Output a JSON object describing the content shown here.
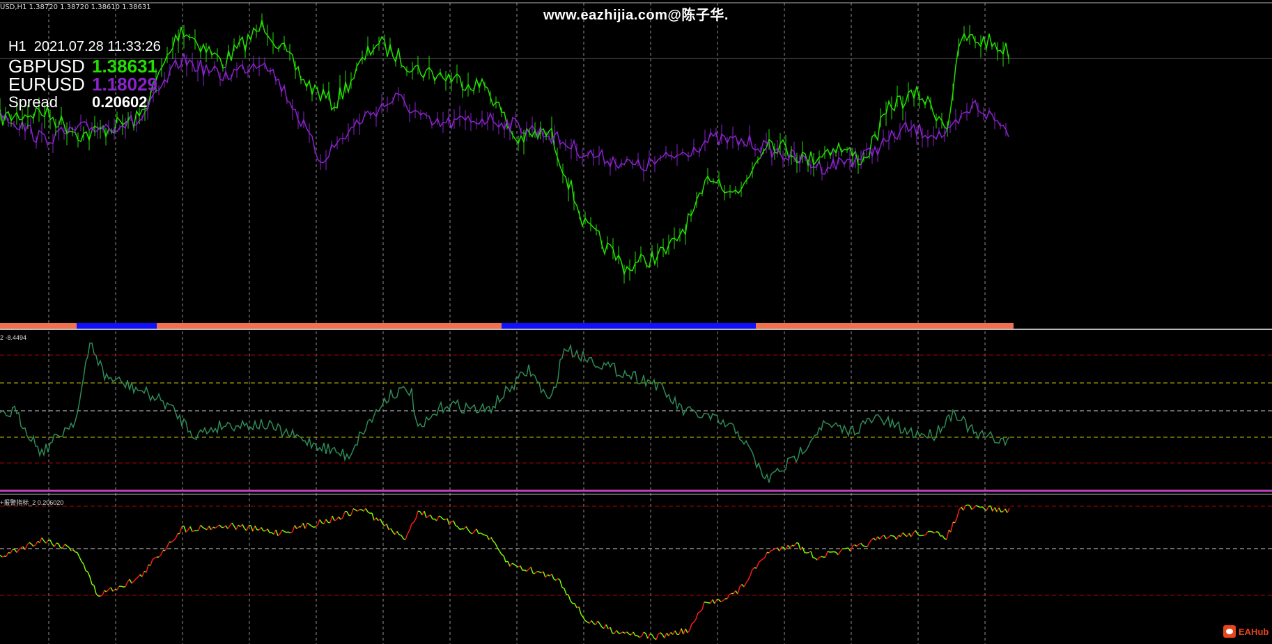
{
  "top_info": "USD,H1  1.38720 1.38720 1.38610 1.38631",
  "watermark": "www.eazhijia.com@陈子华.",
  "timeframe": "H1",
  "datetime": "2021.07.28 11:33:26",
  "symbols": [
    {
      "label": "GBPUSD",
      "value": "1.38631",
      "color": "#22e000"
    },
    {
      "label": "EURUSD",
      "value": "1.18029",
      "color": "#8a22cc"
    },
    {
      "label": "Spread",
      "value": "0.20602",
      "color": "#ffffff"
    }
  ],
  "subwindow_1_label": "2 -8.4494",
  "subwindow_2_label": "+报警指标_2 0.206020",
  "brand": "EAHub",
  "colors": {
    "background": "#000000",
    "grid": "#b4b4b4",
    "gbpusd": "#22e000",
    "eurusd": "#8a22cc",
    "osc_line": "#2e8b57",
    "spread_up": "#7cfc00",
    "spread_down": "#ff1a1a",
    "level_red": "#b00000",
    "level_yellow": "#c8c800",
    "signal_salmon": "#f07050",
    "signal_blue": "#1010ff",
    "separator_magenta": "#c040c0"
  },
  "icons": [
    "eahub-logo-icon"
  ]
}
